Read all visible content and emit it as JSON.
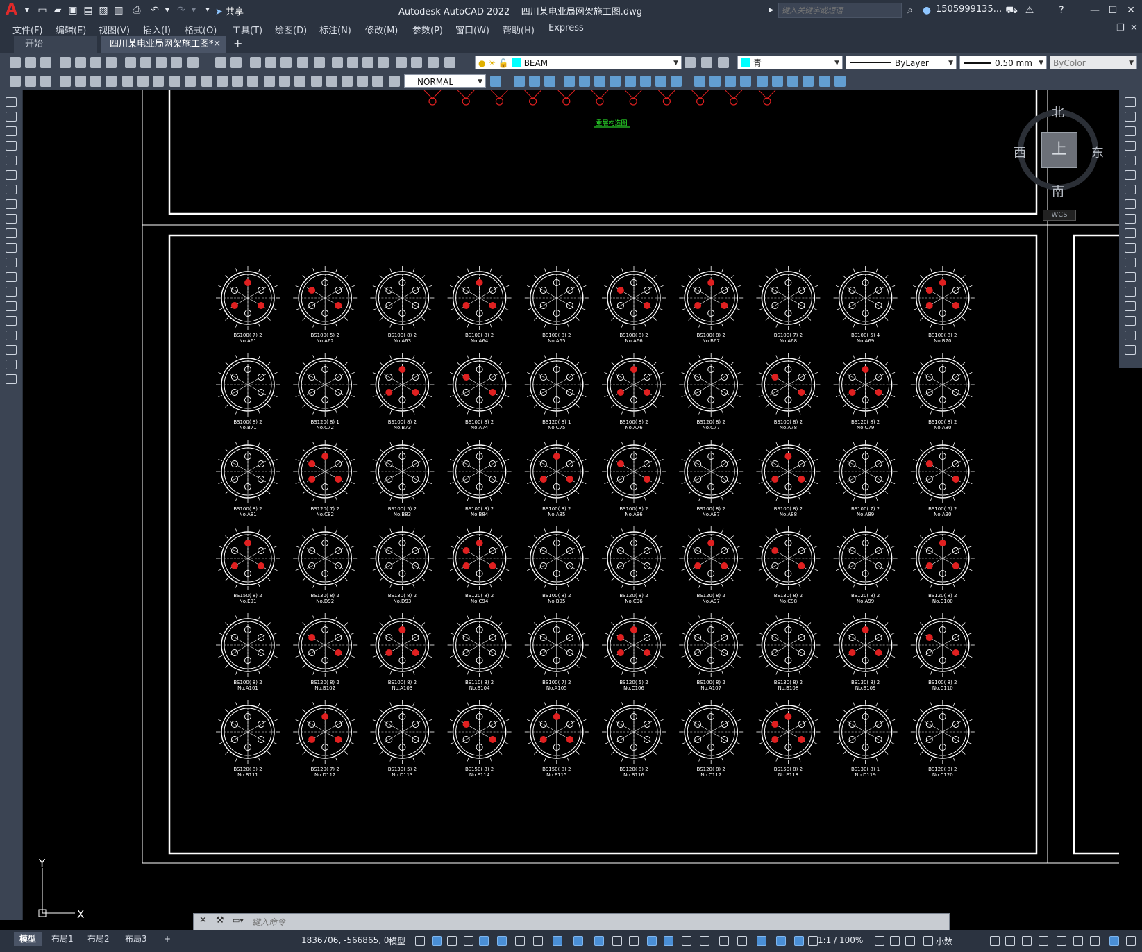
{
  "app": {
    "name": "Autodesk AutoCAD 2022",
    "file": "四川某电业局网架施工图.dwg",
    "share_label": "共享",
    "search_placeholder": "键入关键字或短语",
    "user": "1505999135..."
  },
  "menu": [
    "文件(F)",
    "编辑(E)",
    "视图(V)",
    "插入(I)",
    "格式(O)",
    "工具(T)",
    "绘图(D)",
    "标注(N)",
    "修改(M)",
    "参数(P)",
    "窗口(W)",
    "帮助(H)",
    "Express"
  ],
  "tabs": {
    "start": "开始",
    "doc": "四川某电业局网架施工图*"
  },
  "toolbar": {
    "layer": "BEAM",
    "color": "青",
    "linetype": "ByLayer",
    "lineweight": "0.50 mm",
    "plotstyle": "ByColor",
    "textstyle": "NORMAL"
  },
  "colors": {
    "layer_swatch": "#00ffff",
    "color_swatch": "#00ffff",
    "accent": "#4a8fd6",
    "drawing_red": "#e02020"
  },
  "viewcube": {
    "north": "北",
    "south": "南",
    "east": "东",
    "west": "西",
    "top": "上",
    "wcs": "WCS"
  },
  "ucs": {
    "x": "X",
    "y": "Y"
  },
  "drawing": {
    "upper_caption": "重层构造图",
    "nodes": [
      {
        "l1": "BS100( 7)  2",
        "l2": "No.A61"
      },
      {
        "l1": "BS100( 5)  2",
        "l2": "No.A62"
      },
      {
        "l1": "BS100( 8)  2",
        "l2": "No.A63"
      },
      {
        "l1": "BS100( 8)  2",
        "l2": "No.A64"
      },
      {
        "l1": "BS100( 8)  2",
        "l2": "No.A65"
      },
      {
        "l1": "BS100( 8)  2",
        "l2": "No.A66"
      },
      {
        "l1": "BS100( 8)  2",
        "l2": "No.B67"
      },
      {
        "l1": "BS100( 7)  2",
        "l2": "No.A68"
      },
      {
        "l1": "BS100( 5)  4",
        "l2": "No.A69"
      },
      {
        "l1": "BS100( 8)  2",
        "l2": "No.B70"
      },
      {
        "l1": "BS100( 8)  2",
        "l2": "No.B71"
      },
      {
        "l1": "BS120( 8)  1",
        "l2": "No.C72"
      },
      {
        "l1": "BS100( 8)  2",
        "l2": "No.B73"
      },
      {
        "l1": "BS100( 8)  2",
        "l2": "No.A74"
      },
      {
        "l1": "BS120( 8)  1",
        "l2": "No.C75"
      },
      {
        "l1": "BS100( 8)  2",
        "l2": "No.A76"
      },
      {
        "l1": "BS120( 8)  2",
        "l2": "No.C77"
      },
      {
        "l1": "BS100( 8)  2",
        "l2": "No.A78"
      },
      {
        "l1": "BS120( 8)  2",
        "l2": "No.C79"
      },
      {
        "l1": "BS100( 8)  2",
        "l2": "No.A80"
      },
      {
        "l1": "BS100( 8)  2",
        "l2": "No.A81"
      },
      {
        "l1": "BS120( 7)  2",
        "l2": "No.C82"
      },
      {
        "l1": "BS100( 5)  2",
        "l2": "No.B83"
      },
      {
        "l1": "BS100( 8)  2",
        "l2": "No.B84"
      },
      {
        "l1": "BS100( 8)  2",
        "l2": "No.A85"
      },
      {
        "l1": "BS100( 8)  2",
        "l2": "No.A86"
      },
      {
        "l1": "BS100( 8)  2",
        "l2": "No.A87"
      },
      {
        "l1": "BS100( 8)  2",
        "l2": "No.A88"
      },
      {
        "l1": "BS100( 7)  2",
        "l2": "No.A89"
      },
      {
        "l1": "BS100( 5)  2",
        "l2": "No.A90"
      },
      {
        "l1": "BS150( 8)  2",
        "l2": "No.E91"
      },
      {
        "l1": "BS130( 8)  2",
        "l2": "No.D92"
      },
      {
        "l1": "BS130( 8)  2",
        "l2": "No.D93"
      },
      {
        "l1": "BS120( 8)  2",
        "l2": "No.C94"
      },
      {
        "l1": "BS100( 8)  2",
        "l2": "No.B95"
      },
      {
        "l1": "BS120( 8)  2",
        "l2": "No.C96"
      },
      {
        "l1": "BS120( 8)  2",
        "l2": "No.A97"
      },
      {
        "l1": "BS130( 8)  2",
        "l2": "No.C98"
      },
      {
        "l1": "BS120( 8)  2",
        "l2": "No.A99"
      },
      {
        "l1": "BS120( 8)  2",
        "l2": "No.C100"
      },
      {
        "l1": "BS100( 8)  2",
        "l2": "No.A101"
      },
      {
        "l1": "BS120( 8)  2",
        "l2": "No.B102"
      },
      {
        "l1": "BS100( 8)  2",
        "l2": "No.A103"
      },
      {
        "l1": "BS110( 8)  2",
        "l2": "No.B104"
      },
      {
        "l1": "BS100( 7)  2",
        "l2": "No.A105"
      },
      {
        "l1": "BS120( 5)  2",
        "l2": "No.C106"
      },
      {
        "l1": "BS100( 8)  2",
        "l2": "No.A107"
      },
      {
        "l1": "BS130( 8)  2",
        "l2": "No.B108"
      },
      {
        "l1": "BS130( 8)  2",
        "l2": "No.B109"
      },
      {
        "l1": "BS100( 8)  2",
        "l2": "No.C110"
      },
      {
        "l1": "BS120( 8)  2",
        "l2": "No.B111"
      },
      {
        "l1": "BS120( 7)  2",
        "l2": "No.D112"
      },
      {
        "l1": "BS130( 5)  2",
        "l2": "No.D113"
      },
      {
        "l1": "BS150( 8)  2",
        "l2": "No.E114"
      },
      {
        "l1": "BS150( 8)  2",
        "l2": "No.E115"
      },
      {
        "l1": "BS120( 8)  2",
        "l2": "No.B116"
      },
      {
        "l1": "BS120( 8)  2",
        "l2": "No.C117"
      },
      {
        "l1": "BS150( 8)  2",
        "l2": "No.E118"
      },
      {
        "l1": "BS130( 8)  1",
        "l2": "No.D119"
      },
      {
        "l1": "BS120( 8)  2",
        "l2": "No.C120"
      }
    ]
  },
  "command": {
    "placeholder": "键入命令"
  },
  "status": {
    "layouts": [
      "模型",
      "布局1",
      "布局2",
      "布局3"
    ],
    "coords": "1836706, -566865, 0",
    "model": "模型",
    "scale": "1:1 / 100%",
    "units": "小数"
  }
}
